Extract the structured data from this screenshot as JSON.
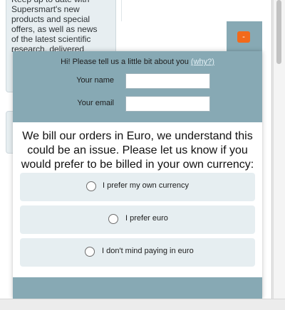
{
  "background": {
    "card_text": "Keep up to date with Supersmart's new products and special offers, as well as news of the latest scientific research, delivered"
  },
  "popup": {
    "close_label": "-",
    "intro_text": "Hi! Please tell us a little bit about you",
    "why_link": "(why?)",
    "name_label": "Your name",
    "name_value": "",
    "email_label": "Your email",
    "email_value": "",
    "message": "We bill our orders in Euro, we understand this could be an issue. Please let us know if you would prefer to be billed in your own currency:",
    "options": [
      {
        "label": "I prefer my own currency",
        "selected": false
      },
      {
        "label": "I prefer euro",
        "selected": false
      },
      {
        "label": "I don't mind paying in euro",
        "selected": false
      }
    ]
  },
  "colors": {
    "header": "#87a9b4",
    "option_bg": "#e6eef1",
    "close_button": "#f26a1b"
  }
}
